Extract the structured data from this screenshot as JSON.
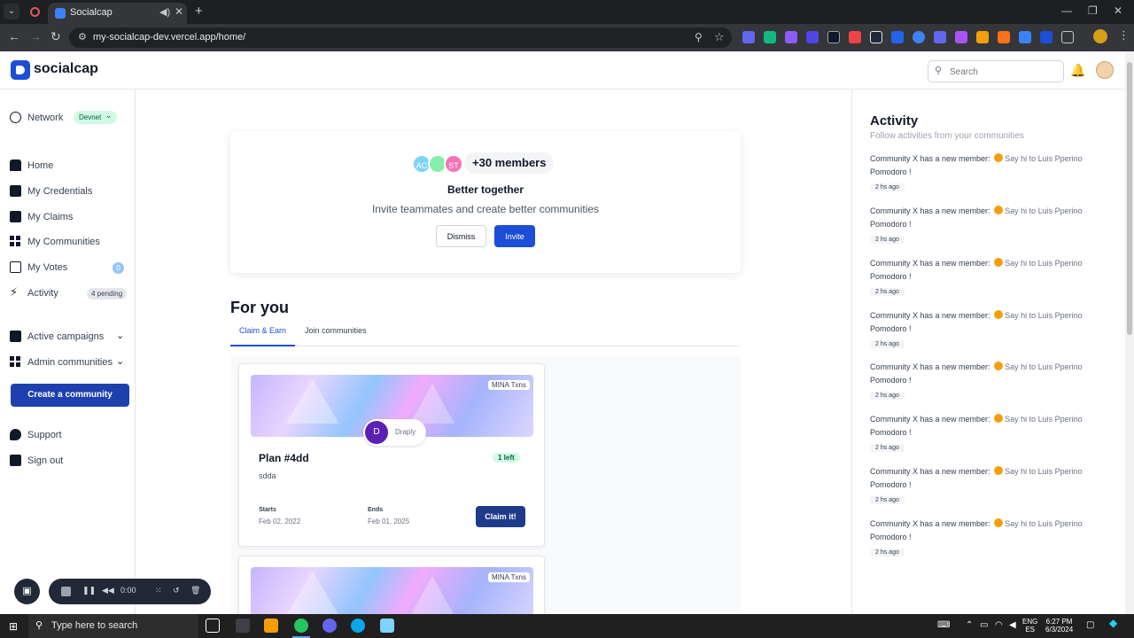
{
  "browser": {
    "tab_title": "Socialcap",
    "url": "my-socialcap-dev.vercel.app/home/"
  },
  "header": {
    "logo_text": "socialcap",
    "search_placeholder": "Search"
  },
  "sidebar": {
    "network_label": "Network",
    "network_value": "Devnet",
    "items": [
      {
        "label": "Home"
      },
      {
        "label": "My Credentials"
      },
      {
        "label": "My Claims"
      },
      {
        "label": "My Communities"
      },
      {
        "label": "My Votes",
        "badge": "0"
      },
      {
        "label": "Activity",
        "badge": "4 pending"
      }
    ],
    "active_campaigns": "Active campaigns",
    "admin_communities": "Admin communities",
    "create_button": "Create a community",
    "support": "Support",
    "sign_out": "Sign out"
  },
  "invite": {
    "avatars": [
      "AC",
      "",
      "ST"
    ],
    "members": "+30 members",
    "title": "Better together",
    "subtitle": "Invite teammates and create better communities",
    "dismiss": "Dismiss",
    "invite": "Invite"
  },
  "for_you": {
    "heading": "For you",
    "tabs": [
      "Claim & Earn",
      "Join communities"
    ],
    "cards": [
      {
        "tag": "MINA Txns",
        "community_initial": "D",
        "community_name": "Draply",
        "title": "Plan #4dd",
        "left": "1 left",
        "description": "sdda",
        "starts_label": "Starts",
        "starts_value": "Feb 02, 2022",
        "ends_label": "Ends",
        "ends_value": "Feb 01, 2025",
        "button": "Claim it!"
      },
      {
        "tag": "MINA Txns"
      }
    ]
  },
  "activity": {
    "title": "Activity",
    "subtitle": "Follow activities from your communities",
    "items": [
      {
        "text": "Community X has a new member:",
        "say": "Say hi to Luis Pperino",
        "name": "Pomodoro !",
        "time": "2 hs ago"
      },
      {
        "text": "Community X has a new member:",
        "say": "Say hi to Luis Pperino",
        "name": "Pomodoro !",
        "time": "2 hs ago"
      },
      {
        "text": "Community X has a new member:",
        "say": "Say hi to Luis Pperino",
        "name": "Pomodoro !",
        "time": "2 hs ago"
      },
      {
        "text": "Community X has a new member:",
        "say": "Say hi to Luis Pperino",
        "name": "Pomodoro !",
        "time": "2 hs ago"
      },
      {
        "text": "Community X has a new member:",
        "say": "Say hi to Luis Pperino",
        "name": "Pomodoro !",
        "time": "2 hs ago"
      },
      {
        "text": "Community X has a new member:",
        "say": "Say hi to Luis Pperino",
        "name": "Pomodoro !",
        "time": "2 hs ago"
      },
      {
        "text": "Community X has a new member:",
        "say": "Say hi to Luis Pperino",
        "name": "Pomodoro !",
        "time": "2 hs ago"
      },
      {
        "text": "Community X has a new member:",
        "say": "Say hi to Luis Pperino",
        "name": "Pomodoro !",
        "time": "2 hs ago"
      }
    ]
  },
  "recorder": {
    "time": "0:00"
  },
  "taskbar": {
    "search_text": "Type here to search",
    "lang_1": "ENG",
    "lang_2": "ES",
    "time": "6:27 PM",
    "date": "6/3/2024"
  },
  "colors": {
    "primary": "#1d4ed8",
    "primary_dark": "#1e40af",
    "success_bg": "#d1fae5"
  }
}
